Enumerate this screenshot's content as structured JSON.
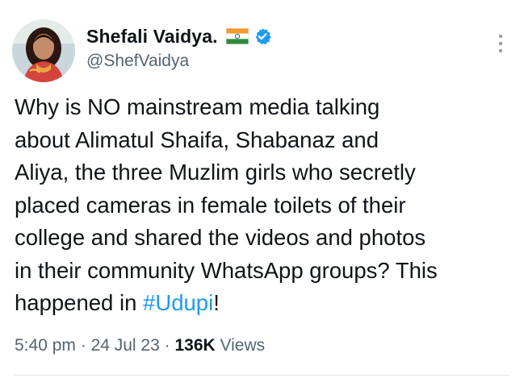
{
  "author": {
    "display_name": "Shefali Vaidya.",
    "handle": "@ShefVaidya",
    "flag_icon": "india-flag-icon",
    "verified_icon": "verified-badge-icon",
    "verified_color": "#1d9bf0"
  },
  "tweet": {
    "lines": [
      "Why is NO mainstream media talking",
      "about Alimatul Shaifa, Shabanaz and",
      "Aliya, the three Muzlim girls who secretly",
      "placed cameras in female toilets of their",
      "college and shared the videos and photos",
      "in their community WhatsApp groups? This"
    ],
    "last_line_prefix": "happened in ",
    "hashtag": "#Udupi",
    "last_line_suffix": "!",
    "hashtag_color": "#1d9bf0"
  },
  "meta": {
    "time": "5:40 pm",
    "sep1": " · ",
    "date": "24 Jul 23",
    "sep2": " · ",
    "views_count": "136K",
    "views_label": " Views"
  },
  "menu": {
    "icon": "more-vertical-icon"
  }
}
